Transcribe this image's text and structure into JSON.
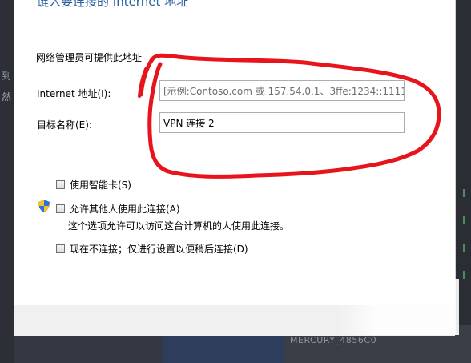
{
  "background": {
    "left_text": [
      "到",
      "然"
    ],
    "network_name": "MERCURY_4856C0"
  },
  "dialog": {
    "title_partial": "键入要连接的 Internet 地址",
    "hint": "网络管理员可提供此地址",
    "internet_address": {
      "label": "Internet 地址(I):",
      "placeholder": "[示例:Contoso.com 或 157.54.0.1、3ffe:1234::1111]"
    },
    "destination_name": {
      "label": "目标名称(E):",
      "value": "VPN 连接 2"
    },
    "options": {
      "smart_card": "使用智能卡(S)",
      "allow_others": "允许其他人使用此连接(A)",
      "allow_others_desc": "这个选项允许可以访问这台计算机的人使用此连接。",
      "connect_later": "现在不连接；仅进行设置以便稍后连接(D)"
    }
  },
  "colors": {
    "annotation": "#e8141c",
    "title": "#2a5fa0"
  },
  "icons": {
    "shield": "uac-shield-icon"
  }
}
